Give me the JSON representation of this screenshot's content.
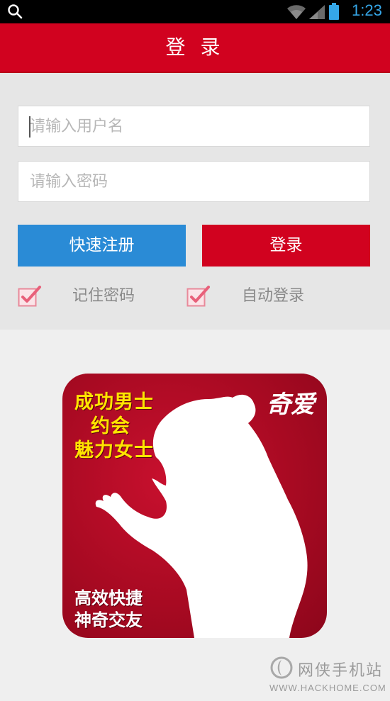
{
  "status_bar": {
    "time": "1:23",
    "icons": [
      "search-icon",
      "wifi-icon",
      "signal-icon",
      "battery-icon"
    ],
    "accent_color": "#35a7e8"
  },
  "header": {
    "title": "登 录",
    "color": "#d1021f"
  },
  "form": {
    "username_placeholder": "请输入用户名",
    "password_placeholder": "请输入密码",
    "register_label": "快速注册",
    "login_label": "登录",
    "remember_label": "记住密码",
    "auto_login_label": "自动登录",
    "remember_checked": true,
    "auto_login_checked": true,
    "register_color": "#2a8bd6",
    "login_color": "#d1021f"
  },
  "promo": {
    "line1": "成功男士",
    "line2": "约会",
    "line3": "魅力女士",
    "brand": "奇爱",
    "bottom1": "高效快捷",
    "bottom2": "神奇交友"
  },
  "watermark": {
    "name": "网侠手机站",
    "url": "WWW.HACKHOME.COM"
  }
}
